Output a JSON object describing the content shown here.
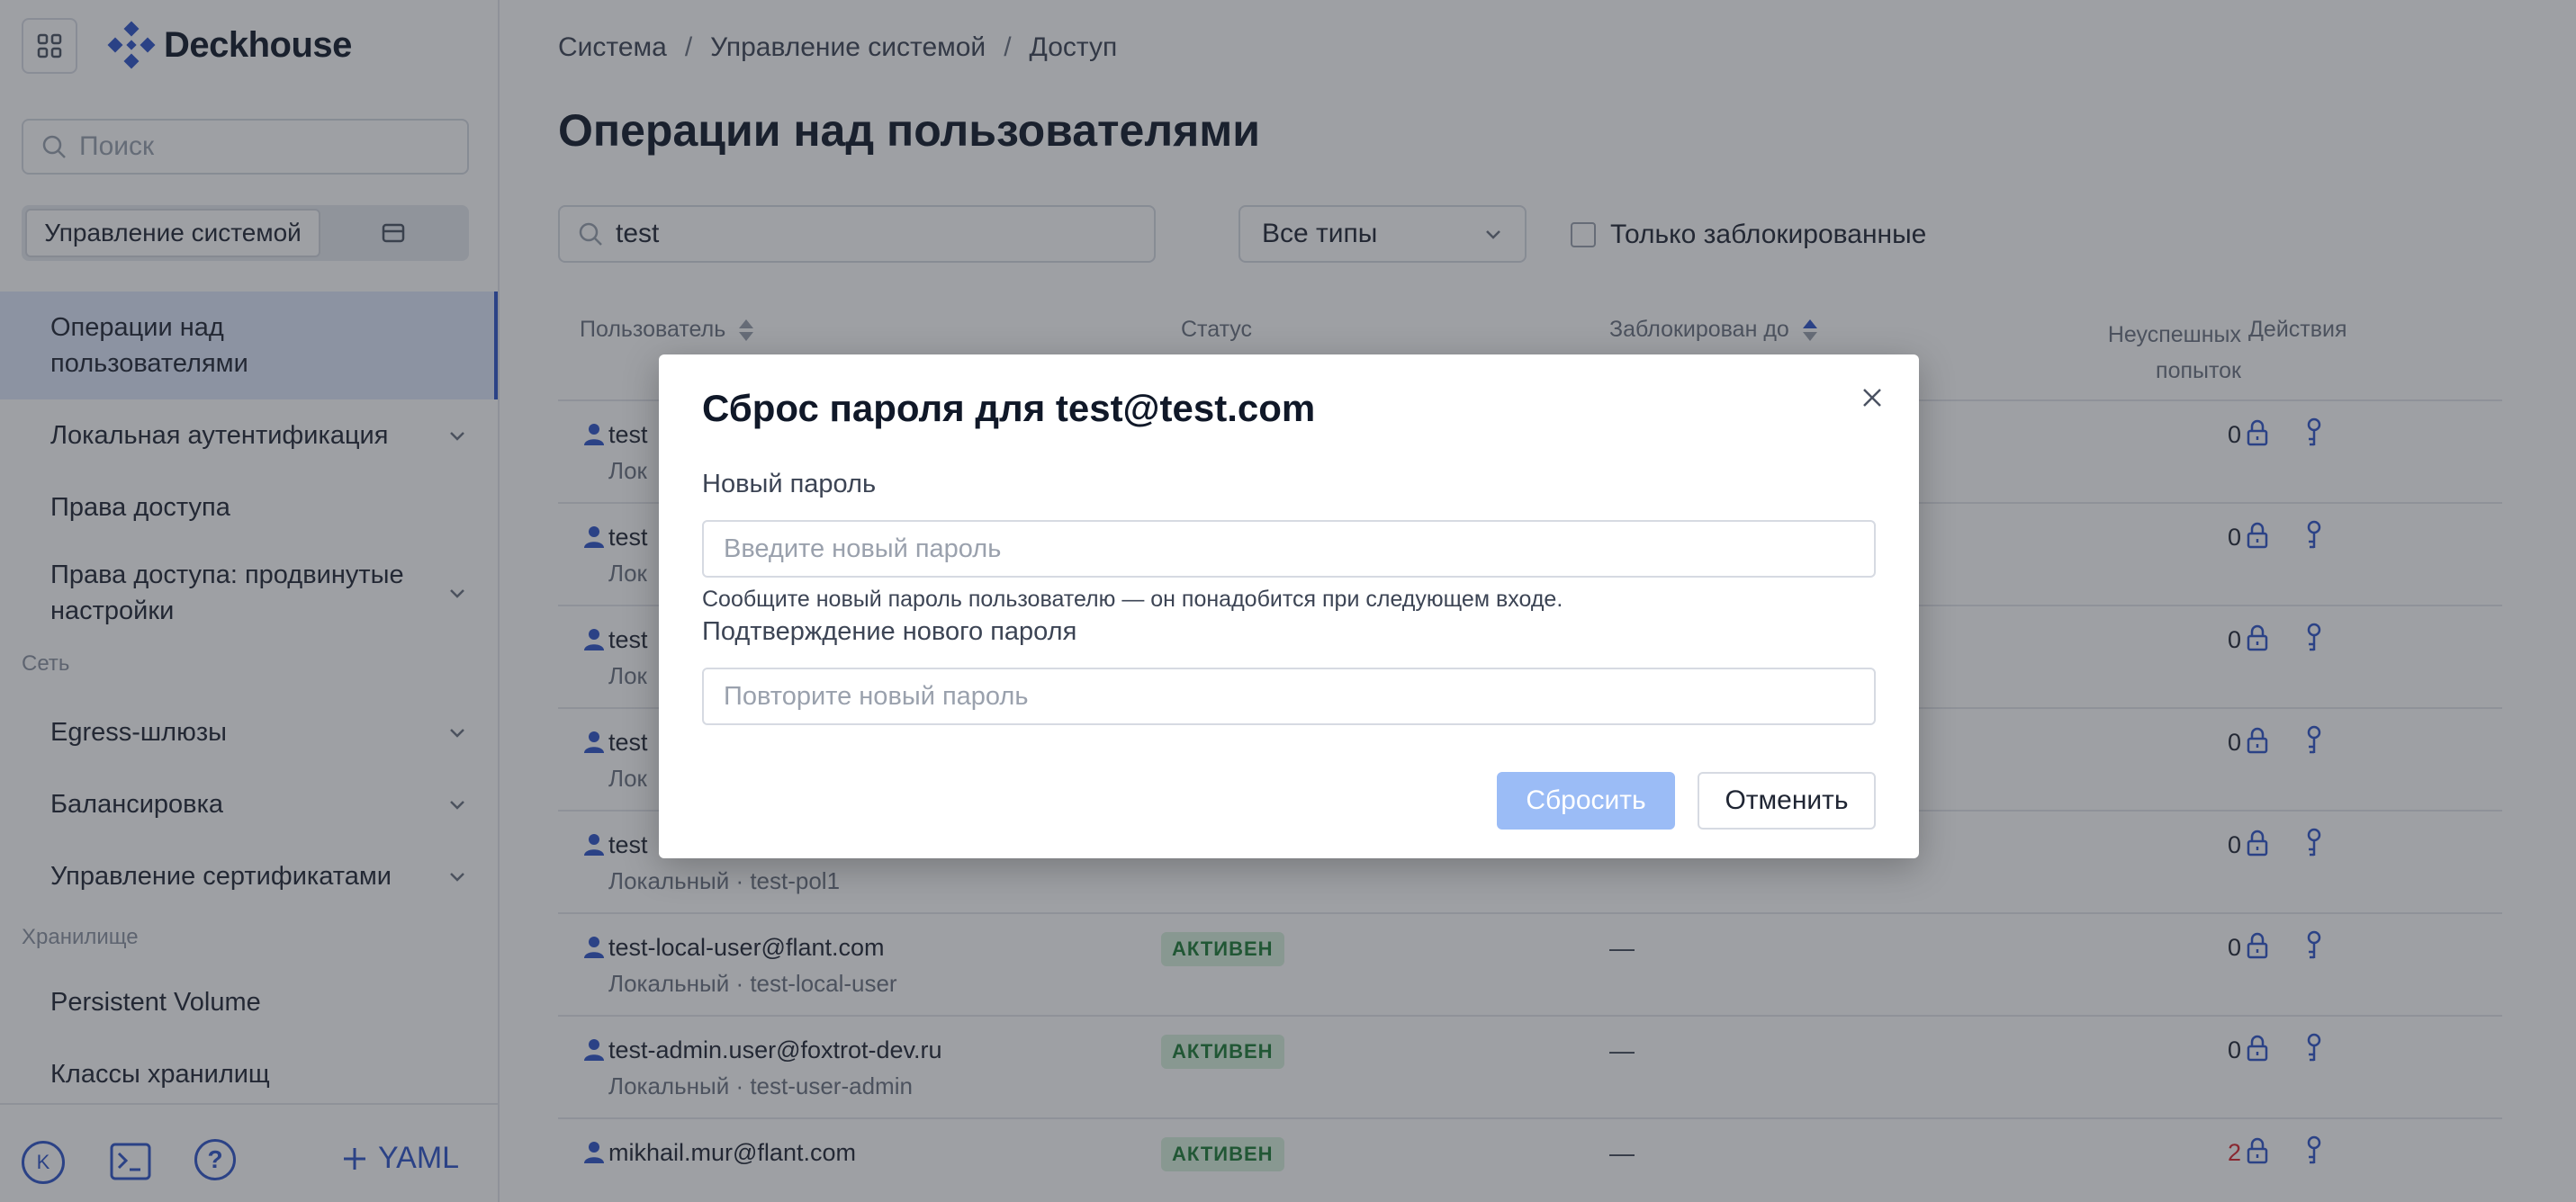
{
  "app": {
    "name": "Deckhouse"
  },
  "sidebar": {
    "search_placeholder": "Поиск",
    "segment_active": "Управление системой",
    "items": [
      {
        "label": "Операции над пользователями",
        "selected": true,
        "expandable": false
      },
      {
        "label": "Локальная аутентификация",
        "selected": false,
        "expandable": true
      },
      {
        "label": "Права доступа",
        "selected": false,
        "expandable": false
      },
      {
        "label": "Права доступа: продвинутые настройки",
        "selected": false,
        "expandable": true
      }
    ],
    "section_network": "Сеть",
    "network_items": [
      {
        "label": "Egress-шлюзы",
        "expandable": true
      },
      {
        "label": "Балансировка",
        "expandable": true
      },
      {
        "label": "Управление сертификатами",
        "expandable": true
      }
    ],
    "section_storage": "Хранилище",
    "storage_items": [
      {
        "label": "Persistent Volume"
      },
      {
        "label": "Классы хранилищ"
      }
    ],
    "bottom": {
      "avatar_letter": "K",
      "yaml_label": "YAML"
    }
  },
  "breadcrumbs": [
    "Система",
    "Управление системой",
    "Доступ"
  ],
  "page_title": "Операции над пользователями",
  "filters": {
    "search_value": "test",
    "type_select": "Все типы",
    "only_blocked_label": "Только заблокированные"
  },
  "table": {
    "headers": {
      "user": "Пользователь",
      "status": "Статус",
      "blocked_until": "Заблокирован до",
      "failed_attempts_line1": "Неуспешных",
      "failed_attempts_line2": "попыток",
      "actions": "Действия"
    },
    "rows": [
      {
        "email": "test",
        "sub": "Лок",
        "status": "",
        "until": "",
        "fails": "0"
      },
      {
        "email": "test",
        "sub": "Лок",
        "status": "",
        "until": "",
        "fails": "0"
      },
      {
        "email": "test",
        "sub": "Лок",
        "status": "",
        "until": "",
        "fails": "0"
      },
      {
        "email": "test",
        "sub": "Лок",
        "status": "",
        "until": "",
        "fails": "0"
      },
      {
        "email": "test",
        "sub": "Локальный · test-pol1",
        "status": "",
        "until": "",
        "fails": "0"
      },
      {
        "email": "test-local-user@flant.com",
        "sub": "Локальный · test-local-user",
        "status": "АКТИВЕН",
        "until": "—",
        "fails": "0"
      },
      {
        "email": "test-admin.user@foxtrot-dev.ru",
        "sub": "Локальный · test-user-admin",
        "status": "АКТИВЕН",
        "until": "—",
        "fails": "0"
      },
      {
        "email": "mikhail.mur@flant.com",
        "sub": "",
        "status": "АКТИВЕН",
        "until": "—",
        "fails": "2"
      }
    ]
  },
  "modal": {
    "title": "Сброс пароля для test@test.com",
    "new_password_label": "Новый пароль",
    "new_password_placeholder": "Введите новый пароль",
    "hint": "Сообщите новый пароль пользователю — он понадобится при следующем входе.",
    "confirm_label": "Подтверждение нового пароля",
    "confirm_placeholder": "Повторите новый пароль",
    "reset_button": "Сбросить",
    "cancel_button": "Отменить"
  },
  "colors": {
    "accent": "#2f54c8",
    "active_badge_bg": "#d8f0dc",
    "active_badge_text": "#1d7a35",
    "danger": "#d9262e",
    "reset_button_disabled": "#9bbcf6"
  }
}
